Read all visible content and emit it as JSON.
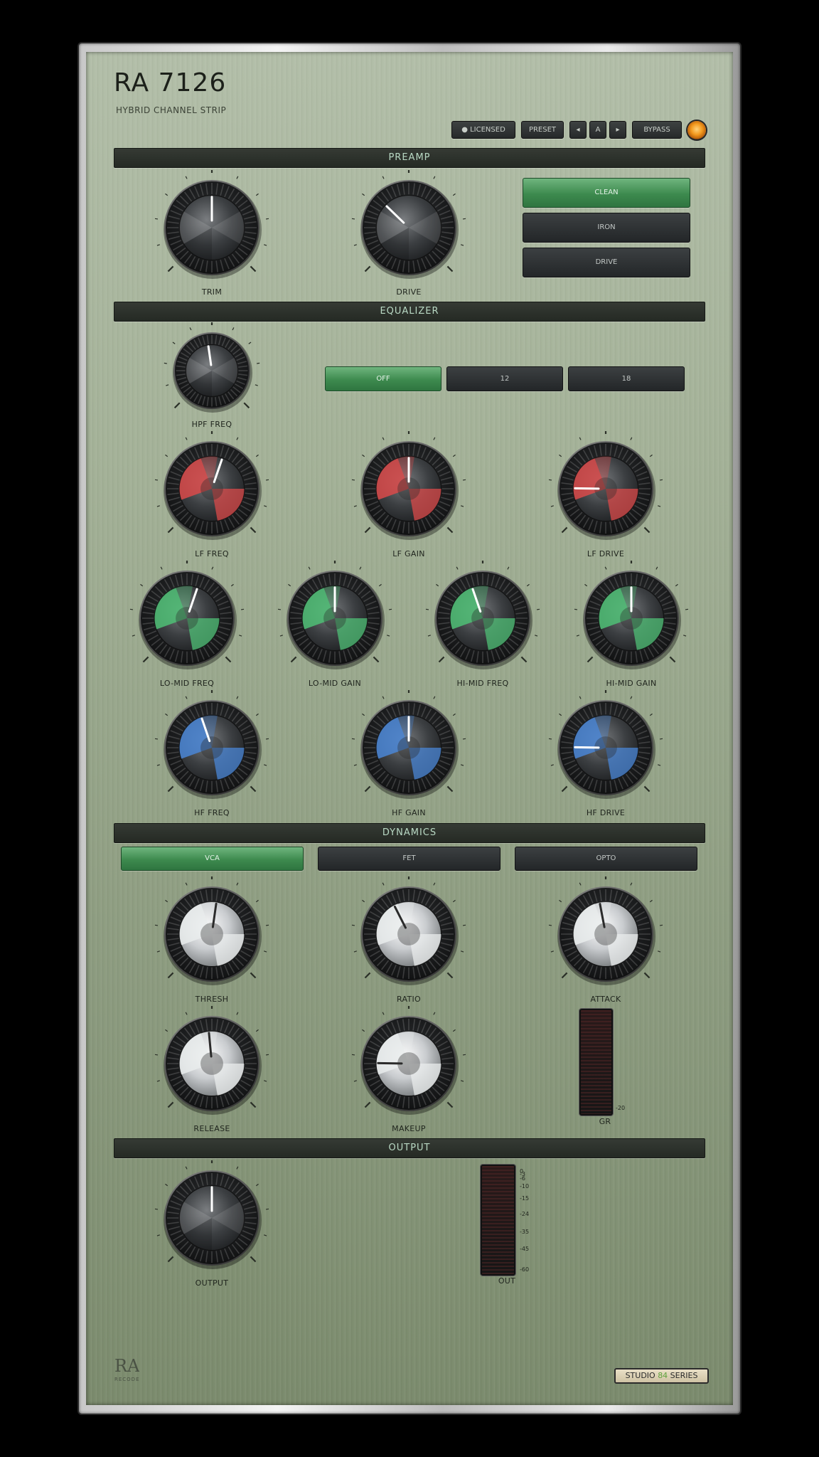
{
  "header": {
    "title": "RA 7126",
    "subtitle": "HYBRID CHANNEL STRIP"
  },
  "toolbar": {
    "licensed": "● LICENSED",
    "preset": "PRESET",
    "prev": "◂",
    "ab": "A",
    "next": "▸",
    "bypass": "BYPASS"
  },
  "sections": {
    "preamp": "PREAMP",
    "equalizer": "EQUALIZER",
    "dynamics": "DYNAMICS",
    "output": "OUTPUT"
  },
  "preamp": {
    "modes": [
      "CLEAN",
      "IRON",
      "DRIVE"
    ],
    "active_mode": "CLEAN"
  },
  "hpf": {
    "slopes": [
      "OFF",
      "12",
      "18"
    ],
    "active_slope": "OFF"
  },
  "dynamics": {
    "modes": [
      "VCA",
      "FET",
      "OPTO"
    ],
    "active_mode": "VCA"
  },
  "knobs": [
    {
      "id": "trim",
      "label": "TRIM",
      "value": 0.5,
      "style": "dark"
    },
    {
      "id": "drive",
      "label": "DRIVE",
      "value": 0.33,
      "style": "dark"
    },
    {
      "id": "hpf-freq",
      "label": "HPF FREQ",
      "value": 0.47,
      "style": "dark"
    },
    {
      "id": "lf-freq",
      "label": "LF FREQ",
      "value": 0.57,
      "style": "red"
    },
    {
      "id": "lf-gain",
      "label": "LF GAIN",
      "value": 0.5,
      "style": "red"
    },
    {
      "id": "lf-drive",
      "label": "LF DRIVE",
      "value": 0.17,
      "style": "red"
    },
    {
      "id": "lo-mid-freq",
      "label": "LO-MID FREQ",
      "value": 0.57,
      "style": "green"
    },
    {
      "id": "lo-mid-gain",
      "label": "LO-MID GAIN",
      "value": 0.5,
      "style": "green"
    },
    {
      "id": "hi-mid-freq",
      "label": "HI-MID FREQ",
      "value": 0.43,
      "style": "green"
    },
    {
      "id": "hi-mid-gain",
      "label": "HI-MID GAIN",
      "value": 0.5,
      "style": "green"
    },
    {
      "id": "hf-freq",
      "label": "HF FREQ",
      "value": 0.43,
      "style": "blue"
    },
    {
      "id": "hf-gain",
      "label": "HF GAIN",
      "value": 0.5,
      "style": "blue"
    },
    {
      "id": "hf-drive",
      "label": "HF DRIVE",
      "value": 0.17,
      "style": "blue"
    },
    {
      "id": "thresh",
      "label": "THRESH",
      "value": 0.53,
      "style": "silver"
    },
    {
      "id": "ratio",
      "label": "RATIO",
      "value": 0.4,
      "style": "silver"
    },
    {
      "id": "attack",
      "label": "ATTACK",
      "value": 0.46,
      "style": "silver"
    },
    {
      "id": "release",
      "label": "RELEASE",
      "value": 0.48,
      "style": "silver"
    },
    {
      "id": "makeup",
      "label": "MAKEUP",
      "value": 0.17,
      "style": "silver"
    },
    {
      "id": "output",
      "label": "OUTPUT",
      "value": 0.5,
      "style": "dark"
    }
  ],
  "gr_meter": {
    "label": "GR",
    "scale_bottom": "-20"
  },
  "out_meter": {
    "label": "OUT",
    "scale": [
      "0",
      "-3",
      "-6",
      "-10",
      "-15",
      "-24",
      "-35",
      "-45",
      "-60"
    ]
  },
  "footer": {
    "logo_mark": "RA",
    "logo_text": "RECODE",
    "badge_pre": "STUDIO ",
    "badge_accent": "84",
    "badge_post": " SERIES"
  },
  "colors": {
    "panel": "#9aa98d",
    "section_bar": "#2b302a",
    "section_text": "#b9d9c4",
    "button_on": "#4a9a5c",
    "knob_red": "#d94a4a",
    "knob_green": "#4fbf75",
    "knob_blue": "#4a86d6",
    "led": "#f39a1e"
  }
}
